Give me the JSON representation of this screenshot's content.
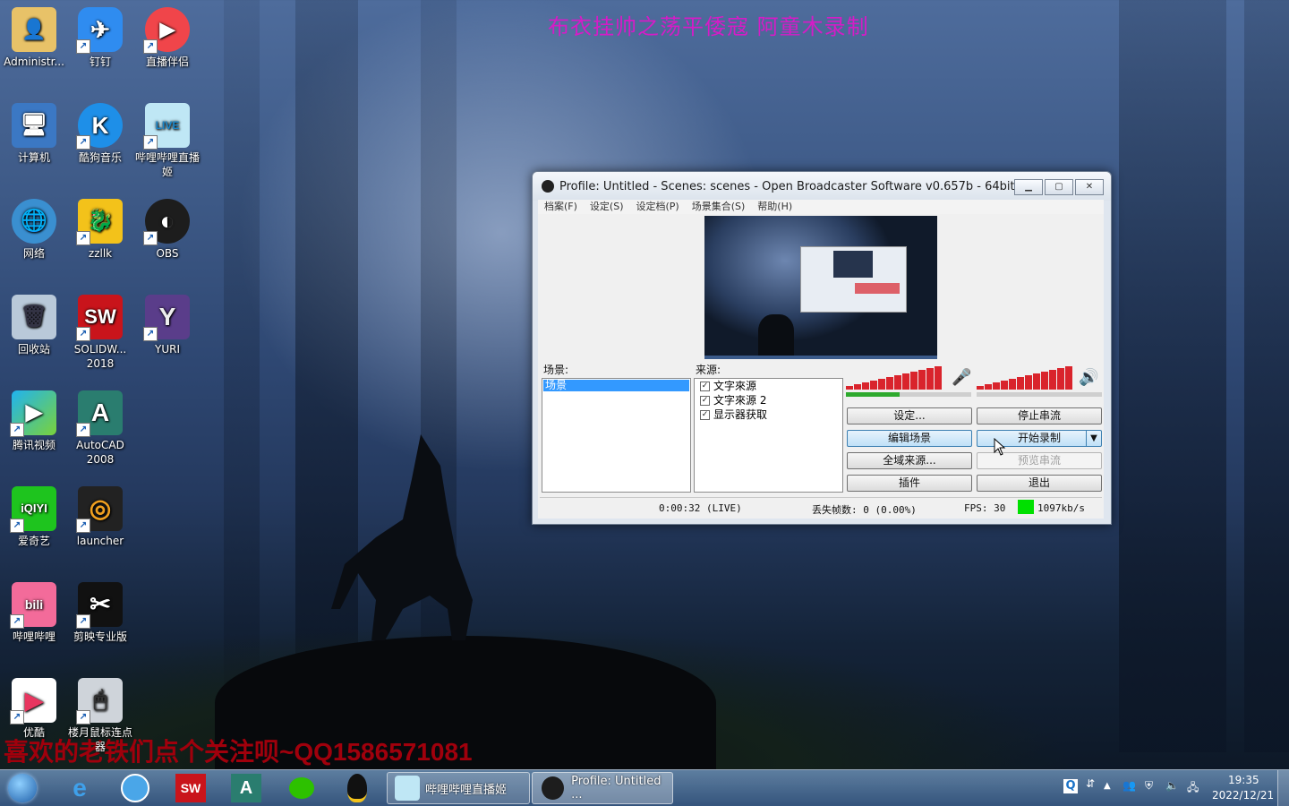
{
  "desktop": {
    "top_banner": "布衣挂帅之荡平倭寇  阿童木录制",
    "bottom_banner": "喜欢的老铁们点个关注呗~QQ1586571081",
    "icons": [
      {
        "label": "Administr...",
        "glyph": "👤"
      },
      {
        "label": "钉钉",
        "glyph": "✈"
      },
      {
        "label": "直播伴侣",
        "glyph": "▶"
      },
      {
        "label": "计算机",
        "glyph": "🖥"
      },
      {
        "label": "酷狗音乐",
        "glyph": "K"
      },
      {
        "label": "哔哩哔哩直播姬",
        "glyph": "LIVE"
      },
      {
        "label": "网络",
        "glyph": "🌐"
      },
      {
        "label": "zzllk",
        "glyph": "🐉"
      },
      {
        "label": "OBS",
        "glyph": "◐"
      },
      {
        "label": "回收站",
        "glyph": "🗑"
      },
      {
        "label": "SOLIDW... 2018",
        "glyph": "SW"
      },
      {
        "label": "YURI",
        "glyph": "Y"
      },
      {
        "label": "腾讯视频",
        "glyph": "▶"
      },
      {
        "label": "AutoCAD 2008",
        "glyph": "A"
      },
      {
        "label": "爱奇艺",
        "glyph": "iQIYI"
      },
      {
        "label": "launcher",
        "glyph": "◎"
      },
      {
        "label": "哔哩哔哩",
        "glyph": "bili"
      },
      {
        "label": "剪映专业版",
        "glyph": "✂"
      },
      {
        "label": "优酷",
        "glyph": "▶"
      },
      {
        "label": "楼月鼠标连点器",
        "glyph": "🖱"
      }
    ]
  },
  "obs": {
    "title": "Profile: Untitled - Scenes: scenes - Open Broadcaster Software v0.657b - 64bit",
    "menu": [
      "档案(F)",
      "设定(S)",
      "设定档(P)",
      "场景集合(S)",
      "帮助(H)"
    ],
    "scenes_label": "场景:",
    "scenes": [
      "场景"
    ],
    "sources_label": "来源:",
    "sources": [
      "文字來源",
      "文字來源 2",
      "显示器获取"
    ],
    "buttons": {
      "settings": "设定...",
      "stop_stream": "停止串流",
      "edit_scene": "编辑场景",
      "start_record": "开始录制",
      "global_sources": "全域来源...",
      "preview_stream": "预览串流",
      "plugins": "插件",
      "exit": "退出"
    },
    "status": {
      "time": "0:00:32 (LIVE)",
      "dropped": "丢失帧数: 0 (0.00%)",
      "fps": "FPS: 30",
      "bitrate": "1097kb/s"
    },
    "colors": {
      "bitrate_indicator": "#00e000",
      "meter": "#d9242c",
      "selected": "#3399ff"
    }
  },
  "taskbar": {
    "task1": "哔哩哔哩直播姬",
    "task2": "Profile: Untitled ...",
    "time": "19:35",
    "date": "2022/12/21"
  }
}
